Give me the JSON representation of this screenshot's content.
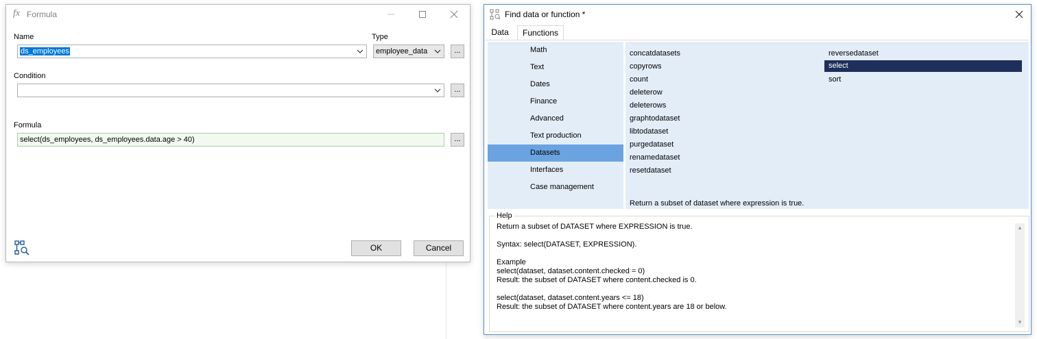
{
  "formula_dialog": {
    "title": "Formula",
    "name_label": "Name",
    "name_value": "ds_employees",
    "type_label": "Type",
    "type_value": "employee_data",
    "condition_label": "Condition",
    "condition_value": "",
    "formula_label": "Formula",
    "formula_value": "select(ds_employees, ds_employees.data.age > 40)",
    "ellipsis_label": "...",
    "ok_label": "OK",
    "cancel_label": "Cancel"
  },
  "find_dialog": {
    "title": "Find data or function *",
    "tabs": [
      {
        "label": "Data"
      },
      {
        "label": "Functions"
      }
    ],
    "categories": [
      {
        "label": "Math"
      },
      {
        "label": "Text"
      },
      {
        "label": "Dates"
      },
      {
        "label": "Finance"
      },
      {
        "label": "Advanced"
      },
      {
        "label": "Text production"
      },
      {
        "label": "Datasets"
      },
      {
        "label": "Interfaces"
      },
      {
        "label": "Case management"
      }
    ],
    "selected_category": "Datasets",
    "functions_col1": [
      "concatdatasets",
      "copyrows",
      "count",
      "deleterow",
      "deleterows",
      "graphtodataset",
      "libtodataset",
      "purgedataset",
      "renamedataset",
      "resetdataset"
    ],
    "functions_col2": [
      "reversedataset",
      "select",
      "sort"
    ],
    "selected_function": "select",
    "function_description": "Return a subset of dataset where expression is true.",
    "help_label": "Help",
    "help_text": "Return a subset of DATASET where EXPRESSION is true.\n\nSyntax: select(DATASET, EXPRESSION).\n\nExample\nselect(dataset, dataset.content.checked = 0)\nResult: the subset of DATASET where content.checked is 0.\n\nselect(dataset, dataset.content.years <= 18)\nResult: the subset of DATASET where content.years are 18 or below."
  },
  "colors": {
    "category_panel_bg": "#e3edf8",
    "category_selected": "#6aa3e0",
    "function_selected": "#1f2f5b",
    "formula_field_bg": "#f0faef",
    "text_selection": "#0078d7"
  }
}
